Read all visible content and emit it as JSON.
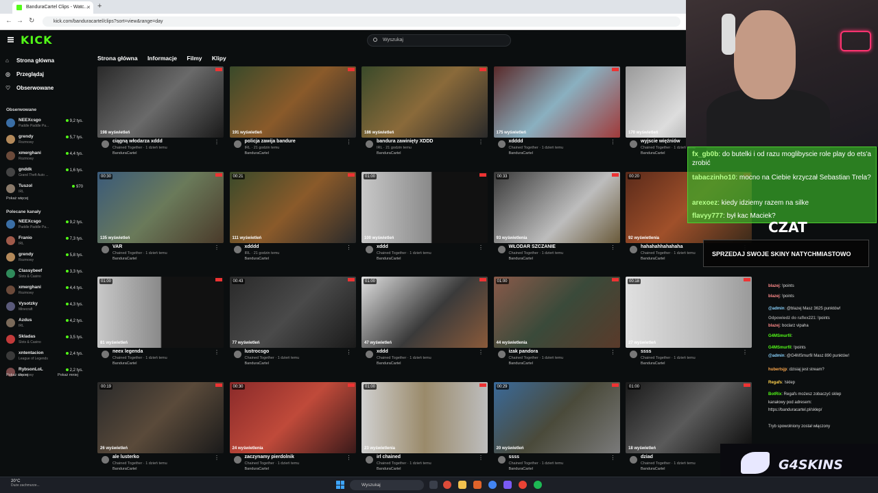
{
  "browser": {
    "tab_title": "BanduraCartel Clips - Watc...",
    "url": "kick.com/banduracartel/clips?sort=view&range=day"
  },
  "header": {
    "logo": "KICK",
    "search_placeholder": "Wyszukaj"
  },
  "sidebar": {
    "nav": [
      {
        "label": "Strona główna",
        "icon": "home-icon"
      },
      {
        "label": "Przeglądaj",
        "icon": "compass-icon"
      },
      {
        "label": "Obserwowane",
        "icon": "heart-icon"
      }
    ],
    "followed_title": "Obserwowane",
    "followed": [
      {
        "name": "NEEXcsgo",
        "category": "Paddle Paddle Pa...",
        "viewers": "9,2 tys.",
        "color": "#3a6ea5"
      },
      {
        "name": "grendy",
        "category": "Rozmowy",
        "viewers": "5,7 tys.",
        "color": "#b3895a"
      },
      {
        "name": "xmerghani",
        "category": "Rozmowy",
        "viewers": "4,4 tys.",
        "color": "#6b4a3a"
      },
      {
        "name": "gnddk",
        "category": "Grand Theft Auto ...",
        "viewers": "1,6 tys.",
        "color": "#444444"
      },
      {
        "name": "Tuszol",
        "category": "IRL",
        "viewers": "970",
        "color": "#8a7a6a"
      }
    ],
    "show_more": "Pokaż więcej",
    "recommended_title": "Polecane kanały",
    "recommended": [
      {
        "name": "NEEXcsgo",
        "category": "Paddle Paddle Pa...",
        "viewers": "9,2 tys.",
        "color": "#3a6ea5"
      },
      {
        "name": "Franio",
        "category": "IRL",
        "viewers": "7,3 tys.",
        "color": "#a05a4a"
      },
      {
        "name": "grendy",
        "category": "Rozmowy",
        "viewers": "5,8 tys.",
        "color": "#b3895a"
      },
      {
        "name": "Classybeef",
        "category": "Slots & Casino",
        "viewers": "3,3 tys.",
        "color": "#2f8a5a"
      },
      {
        "name": "xmerghani",
        "category": "Rozmowy",
        "viewers": "4,4 tys.",
        "color": "#6b4a3a"
      },
      {
        "name": "Vysotzky",
        "category": "Minecraft",
        "viewers": "4,3 tys.",
        "color": "#5a5a7a"
      },
      {
        "name": "Azdus",
        "category": "IRL",
        "viewers": "4,2 tys.",
        "color": "#7a6a5a"
      },
      {
        "name": "Skladas",
        "category": "Slots & Casino",
        "viewers": "3,5 tys.",
        "color": "#c23a3a"
      },
      {
        "name": "xntentacion",
        "category": "League of Legends",
        "viewers": "2,4 tys.",
        "color": "#3a3a3a"
      },
      {
        "name": "RybsonLoL",
        "category": "Rozmowy",
        "viewers": "2,2 tys.",
        "color": "#7a4a4a"
      }
    ],
    "show_more_2": "Pokaż więcej",
    "show_less": "Pokaż mniej"
  },
  "channel_tabs": [
    "Strona główna",
    "Informacje",
    "Filmy",
    "Klipy"
  ],
  "clips": [
    {
      "title": "ciągną włodarza xddd",
      "sub": "Chained Together · 1 dzień temu",
      "channel": "BanduraCartel",
      "views": "198 wyświetleń",
      "duration": "",
      "bg": "linear-gradient(135deg,#2a2a2a,#6a6a6a 50%,#1a1a1a)"
    },
    {
      "title": "policja zawija bandure",
      "sub": "IRL · 21 godzin temu",
      "channel": "BanduraCartel",
      "views": "191 wyświetleń",
      "duration": "",
      "bg": "linear-gradient(135deg,#3a4a2a,#8a5a2a 50%,#2a2a2a)"
    },
    {
      "title": "bandura zawinięty XDDD",
      "sub": "IRL · 21 godzin temu",
      "channel": "BanduraCartel",
      "views": "186 wyświetleń",
      "duration": "",
      "bg": "linear-gradient(135deg,#3a4a2a,#8a6a3a 50%,#2a2a2a)"
    },
    {
      "title": "xdddd",
      "sub": "Chained Together · 1 dzień temu",
      "channel": "BanduraCartel",
      "views": "175 wyświetleń",
      "duration": "",
      "bg": "linear-gradient(135deg,#5a2a2a,#8ab0c0 50%,#a03a3a)"
    },
    {
      "title": "wyjscie więźniów",
      "sub": "Chained Together · 1 dzień temu",
      "channel": "BanduraCartel",
      "views": "170 wyświetleń",
      "duration": "",
      "bg": "linear-gradient(135deg,#9a9a9a,#dddddd 50%,#7a7a7a)"
    },
    {
      "title": "VAR",
      "sub": "Chained Together · 1 dzień temu",
      "channel": "BanduraCartel",
      "views": "135 wyświetleń",
      "duration": "00:30",
      "bg": "linear-gradient(135deg,#3a5a7a,#6a7a5a 50%,#4a3a2a)"
    },
    {
      "title": "xdddd",
      "sub": "IRL · 21 godzin temu",
      "channel": "BanduraCartel",
      "views": "111 wyświetleń",
      "duration": "00:21",
      "bg": "linear-gradient(135deg,#3a4a2a,#8a5a2a 50%,#2a2a2a)"
    },
    {
      "title": "xddd",
      "sub": "Chained Together · 1 dzień temu",
      "channel": "BanduraCartel",
      "views": "100 wyświetleń",
      "duration": "01:00",
      "bg": "linear-gradient(90deg,#c8c8c8,#8a8a8a 55%,#111111 56%)"
    },
    {
      "title": "WŁODAR SZCZANIE",
      "sub": "Chained Together · 1 dzień temu",
      "channel": "BanduraCartel",
      "views": "93 wyświetlenia",
      "duration": "00:33",
      "bg": "linear-gradient(135deg,#3a3a3a,#bdbdbd 60%,#6a5a3a)"
    },
    {
      "title": "hahahahhahahaha",
      "sub": "Chained Together · 1 dzień temu",
      "channel": "BanduraCartel",
      "views": "92 wyświetlenia",
      "duration": "00:20",
      "bg": "linear-gradient(135deg,#5a2a1a,#a0502a 50%,#3a2a1a)"
    },
    {
      "title": "neex legenda",
      "sub": "Chained Together · 1 dzień temu",
      "channel": "BanduraCartel",
      "views": "81 wyświetleń",
      "duration": "01:00",
      "bg": "linear-gradient(90deg,#c8c8c8,#8a8a8a 50%,#111111 51%)"
    },
    {
      "title": "lustrocsgo",
      "sub": "Chained Together · 1 dzień temu",
      "channel": "BanduraCartel",
      "views": "77 wyświetleń",
      "duration": "00:43",
      "bg": "linear-gradient(135deg,#2a2a2a,#4a4a4a 50%,#1a1a1a)"
    },
    {
      "title": "xddd",
      "sub": "Chained Together · 1 dzień temu",
      "channel": "BanduraCartel",
      "views": "47 wyświetleń",
      "duration": "01:00",
      "bg": "linear-gradient(135deg,#e0e0e0,#3a3a3a 55%,#8a5a3a)"
    },
    {
      "title": "izak pandora",
      "sub": "Chained Together · 1 dzień temu",
      "channel": "BanduraCartel",
      "views": "44 wyświetlenia",
      "duration": "01:00",
      "bg": "linear-gradient(135deg,#8a5a4a,#3a4a3a 50%,#5a3a2a)"
    },
    {
      "title": "ssss",
      "sub": "Chained Together · 1 dzień temu",
      "channel": "BanduraCartel",
      "views": "27 wyświetleń",
      "duration": "00:18",
      "bg": "linear-gradient(90deg,#e0e0e0,#bdbdbd 60%,#9a9a9a)"
    },
    {
      "title": "ale lusterko",
      "sub": "Chained Together · 1 dzień temu",
      "channel": "BanduraCartel",
      "views": "26 wyświetleń",
      "duration": "00:19",
      "bg": "linear-gradient(135deg,#2a2a2a,#5a4a3a 50%,#1a1a1a)"
    },
    {
      "title": "zaczynamy pierdolnik",
      "sub": "Chained Together · 1 dzień temu",
      "channel": "BanduraCartel",
      "views": "24 wyświetlenia",
      "duration": "00:30",
      "bg": "linear-gradient(135deg,#8a2a2a,#c04a3a 50%,#3a1a1a)"
    },
    {
      "title": "irl chained",
      "sub": "Chained Together · 1 dzień temu",
      "channel": "BanduraCartel",
      "views": "23 wyświetlenia",
      "duration": "01:00",
      "bg": "linear-gradient(90deg,#d0d0d0,#9a8a6a 50%,#bdbdbd)"
    },
    {
      "title": "ssss",
      "sub": "Chained Together · 1 dzień temu",
      "channel": "BanduraCartel",
      "views": "20 wyświetleń",
      "duration": "00:29",
      "bg": "linear-gradient(135deg,#3a6a9a,#4a4a3a 50%,#7a7a7a)"
    },
    {
      "title": "dziad",
      "sub": "Chained Together · 1 dzień temu",
      "channel": "BanduraCartel",
      "views": "18 wyświetleń",
      "duration": "01:00",
      "bg": "linear-gradient(135deg,#1a1a1a,#5a5a5a 50%,#0a0a0a)"
    }
  ],
  "overlay_chat": [
    {
      "user": "fx_gb0b",
      "text": ": do butelki i od razu moglibyscie role play do ets'a zrobić"
    },
    {
      "user": "tabaczinho10",
      "text": ": mocno na Ciebie krzyczał Sebastian Trela?"
    },
    {
      "user": "arexoez",
      "text": ": kiedy idziemy razem na silke"
    },
    {
      "user": "flavyy777",
      "text": ": był kac Maciek?"
    }
  ],
  "czat_label": "CZAT",
  "banner_text": "SPRZEDAJ SWOJE SKINY NATYCHMIASTOWO",
  "chat_messages": [
    {
      "user": "blazej",
      "text": ": !points",
      "color": "#ff8a8a"
    },
    {
      "user": "blazej",
      "text": ": !points",
      "color": "#ff8a8a"
    },
    {
      "user": "@admin",
      "text": ": @blazej Masz 3625 punktów!",
      "color": "#8ad4ff"
    },
    {
      "user": "Odpowiedź do raflex221",
      "text": ": !points",
      "color": "#999999"
    },
    {
      "user": "blazej",
      "text": ": boclarz vipaha",
      "color": "#ff8a8a"
    },
    {
      "user": "G4MSmurfil",
      "text": ":",
      "color": "#53fc18"
    },
    {
      "user": "G4MSmurfil",
      "text": ": !points",
      "color": "#53fc18"
    },
    {
      "user": "@admin",
      "text": ": @G4MSmurfil Masz 890 punktów!",
      "color": "#8ad4ff"
    },
    {
      "user": "hubertsjp",
      "text": ": dzisiaj jest stream?",
      "color": "#ffa94d"
    },
    {
      "user": "Regafs",
      "text": ": !sklep",
      "color": "#ffd24d"
    },
    {
      "user": "BotRix",
      "text": ": Regafs możesz zobaczyć sklep",
      "color": "#53fc18"
    },
    {
      "user": "",
      "text": "kanałowy pod adresem:",
      "color": "#dddddd"
    },
    {
      "user": "",
      "text": "https://banduracartel.pl/sklep/",
      "color": "#8ad4ff"
    },
    {
      "user": "",
      "text": "Tryb spowolniony został włączony",
      "color": "#999999"
    }
  ],
  "g4skins_text": "G4SKINS",
  "taskbar": {
    "temp": "20°C",
    "weather": "Duże zachmurze...",
    "search_placeholder": "Wyszukaj"
  },
  "colors": {
    "accent": "#53fc18",
    "bg": "#0b0e0f"
  }
}
